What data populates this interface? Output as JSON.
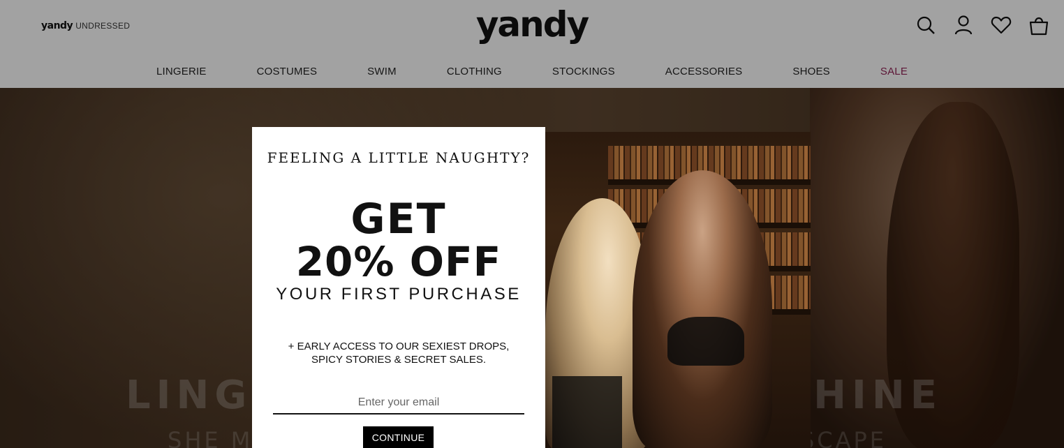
{
  "header": {
    "sub_brand_main": "yandy",
    "sub_brand_suffix": "UNDRESSED",
    "logo": "yandy",
    "icons": [
      "search-icon",
      "account-icon",
      "wishlist-heart-icon",
      "shopping-bag-icon"
    ],
    "nav": [
      {
        "label": "LINGERIE"
      },
      {
        "label": "COSTUMES"
      },
      {
        "label": "SWIM"
      },
      {
        "label": "CLOTHING"
      },
      {
        "label": "STOCKINGS"
      },
      {
        "label": "ACCESSORIES"
      },
      {
        "label": "SHOES"
      },
      {
        "label": "SALE"
      }
    ],
    "sale_color": "#8b2252"
  },
  "hero": {
    "title_left": "LING",
    "title_right": "HINE",
    "sub_left": "SHE M",
    "sub_right": "SCAPE"
  },
  "popup": {
    "tagline": "FEELING A LITTLE NAUGHTY?",
    "headline_1": "GET",
    "headline_2": "20% OFF",
    "headline_3": "YOUR FIRST PURCHASE",
    "perks": "+ EARLY ACCESS TO OUR SEXIEST DROPS, SPICY STORIES & SECRET SALES.",
    "email_placeholder": "Enter your email",
    "continue_label": "CONTINUE"
  }
}
